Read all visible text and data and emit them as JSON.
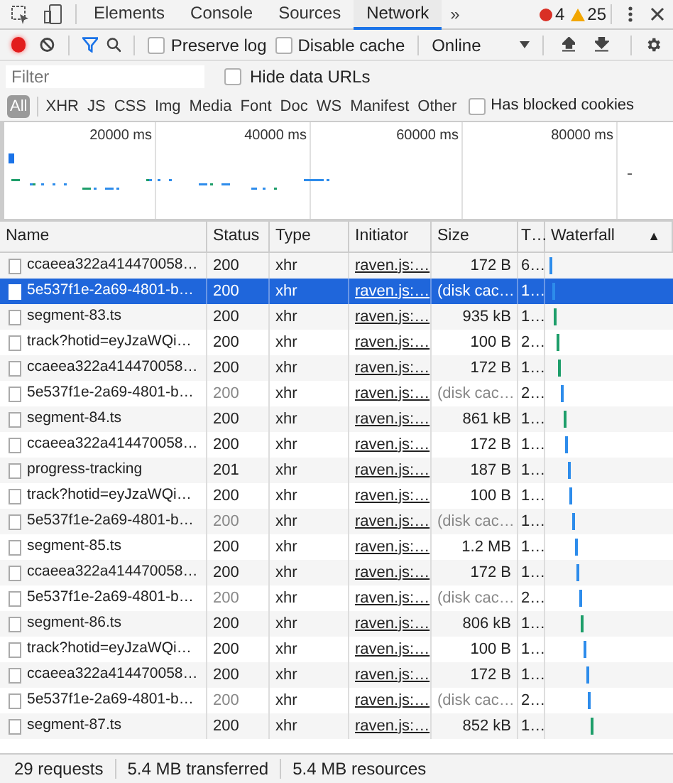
{
  "tabs": [
    {
      "label": "Elements",
      "selected": false
    },
    {
      "label": "Console",
      "selected": false
    },
    {
      "label": "Sources",
      "selected": false
    },
    {
      "label": "Network",
      "selected": true
    }
  ],
  "more_tabs": "»",
  "errors": "4",
  "warnings": "25",
  "toolbar": {
    "recording": true,
    "filter_active": true,
    "checkboxes": [
      {
        "label": "Preserve log",
        "checked": false
      },
      {
        "label": "Disable cache",
        "checked": false
      }
    ],
    "throttling": "Online"
  },
  "filter": {
    "placeholder": "Filter",
    "hide_data_urls": {
      "label": "Hide data URLs",
      "checked": false
    }
  },
  "type_filters": [
    {
      "label": "All",
      "selected": true
    },
    {
      "label": "XHR",
      "selected": false
    },
    {
      "label": "JS",
      "selected": false
    },
    {
      "label": "CSS",
      "selected": false
    },
    {
      "label": "Img",
      "selected": false
    },
    {
      "label": "Media",
      "selected": false
    },
    {
      "label": "Font",
      "selected": false
    },
    {
      "label": "Doc",
      "selected": false
    },
    {
      "label": "WS",
      "selected": false
    },
    {
      "label": "Manifest",
      "selected": false
    },
    {
      "label": "Other",
      "selected": false
    }
  ],
  "blocked_cookies": {
    "label": "Has blocked cookies",
    "checked": false
  },
  "overview": {
    "ticks": [
      "20000 ms",
      "40000 ms",
      "60000 ms",
      "80000 ms"
    ]
  },
  "columns": [
    "Name",
    "Status",
    "Type",
    "Initiator",
    "Size",
    "T…",
    "Waterfall"
  ],
  "sort_indicator": "▲",
  "rows": [
    {
      "name": "ccaeea322a414470058…",
      "status": "200",
      "type": "xhr",
      "initiator": "raven.js:…",
      "size": "172 B",
      "time": "6…",
      "cached": false,
      "selected": false,
      "color": "#2d8ceb"
    },
    {
      "name": "5e537f1e-2a69-4801-b…",
      "status": "200",
      "type": "xhr",
      "initiator": "raven.js:…",
      "size": "(disk cac…",
      "time": "1…",
      "cached": true,
      "selected": true,
      "color": "#2d8ceb"
    },
    {
      "name": "segment-83.ts",
      "status": "200",
      "type": "xhr",
      "initiator": "raven.js:…",
      "size": "935 kB",
      "time": "1…",
      "cached": false,
      "selected": false,
      "color": "#1e9e6a"
    },
    {
      "name": "track?hotid=eyJzaWQi…",
      "status": "200",
      "type": "xhr",
      "initiator": "raven.js:…",
      "size": "100 B",
      "time": "2…",
      "cached": false,
      "selected": false,
      "color": "#1e9e6a"
    },
    {
      "name": "ccaeea322a414470058…",
      "status": "200",
      "type": "xhr",
      "initiator": "raven.js:…",
      "size": "172 B",
      "time": "1…",
      "cached": false,
      "selected": false,
      "color": "#1e9e6a"
    },
    {
      "name": "5e537f1e-2a69-4801-b…",
      "status": "200",
      "type": "xhr",
      "initiator": "raven.js:…",
      "size": "(disk cac…",
      "time": "2…",
      "cached": true,
      "selected": false,
      "color": "#2d8ceb"
    },
    {
      "name": "segment-84.ts",
      "status": "200",
      "type": "xhr",
      "initiator": "raven.js:…",
      "size": "861 kB",
      "time": "1…",
      "cached": false,
      "selected": false,
      "color": "#1e9e6a"
    },
    {
      "name": "ccaeea322a414470058…",
      "status": "200",
      "type": "xhr",
      "initiator": "raven.js:…",
      "size": "172 B",
      "time": "1…",
      "cached": false,
      "selected": false,
      "color": "#2d8ceb"
    },
    {
      "name": "progress-tracking",
      "status": "201",
      "type": "xhr",
      "initiator": "raven.js:…",
      "size": "187 B",
      "time": "1…",
      "cached": false,
      "selected": false,
      "color": "#2d8ceb"
    },
    {
      "name": "track?hotid=eyJzaWQi…",
      "status": "200",
      "type": "xhr",
      "initiator": "raven.js:…",
      "size": "100 B",
      "time": "1…",
      "cached": false,
      "selected": false,
      "color": "#2d8ceb"
    },
    {
      "name": "5e537f1e-2a69-4801-b…",
      "status": "200",
      "type": "xhr",
      "initiator": "raven.js:…",
      "size": "(disk cac…",
      "time": "1…",
      "cached": true,
      "selected": false,
      "color": "#2d8ceb"
    },
    {
      "name": "segment-85.ts",
      "status": "200",
      "type": "xhr",
      "initiator": "raven.js:…",
      "size": "1.2 MB",
      "time": "1…",
      "cached": false,
      "selected": false,
      "color": "#2d8ceb"
    },
    {
      "name": "ccaeea322a414470058…",
      "status": "200",
      "type": "xhr",
      "initiator": "raven.js:…",
      "size": "172 B",
      "time": "1…",
      "cached": false,
      "selected": false,
      "color": "#2d8ceb"
    },
    {
      "name": "5e537f1e-2a69-4801-b…",
      "status": "200",
      "type": "xhr",
      "initiator": "raven.js:…",
      "size": "(disk cac…",
      "time": "2…",
      "cached": true,
      "selected": false,
      "color": "#2d8ceb"
    },
    {
      "name": "segment-86.ts",
      "status": "200",
      "type": "xhr",
      "initiator": "raven.js:…",
      "size": "806 kB",
      "time": "1…",
      "cached": false,
      "selected": false,
      "color": "#1e9e6a"
    },
    {
      "name": "track?hotid=eyJzaWQi…",
      "status": "200",
      "type": "xhr",
      "initiator": "raven.js:…",
      "size": "100 B",
      "time": "1…",
      "cached": false,
      "selected": false,
      "color": "#2d8ceb"
    },
    {
      "name": "ccaeea322a414470058…",
      "status": "200",
      "type": "xhr",
      "initiator": "raven.js:…",
      "size": "172 B",
      "time": "1…",
      "cached": false,
      "selected": false,
      "color": "#2d8ceb"
    },
    {
      "name": "5e537f1e-2a69-4801-b…",
      "status": "200",
      "type": "xhr",
      "initiator": "raven.js:…",
      "size": "(disk cac…",
      "time": "2…",
      "cached": true,
      "selected": false,
      "color": "#2d8ceb"
    },
    {
      "name": "segment-87.ts",
      "status": "200",
      "type": "xhr",
      "initiator": "raven.js:…",
      "size": "852 kB",
      "time": "1…",
      "cached": false,
      "selected": false,
      "color": "#1e9e6a"
    }
  ],
  "status_bar": [
    "29 requests",
    "5.4 MB transferred",
    "5.4 MB resources"
  ]
}
